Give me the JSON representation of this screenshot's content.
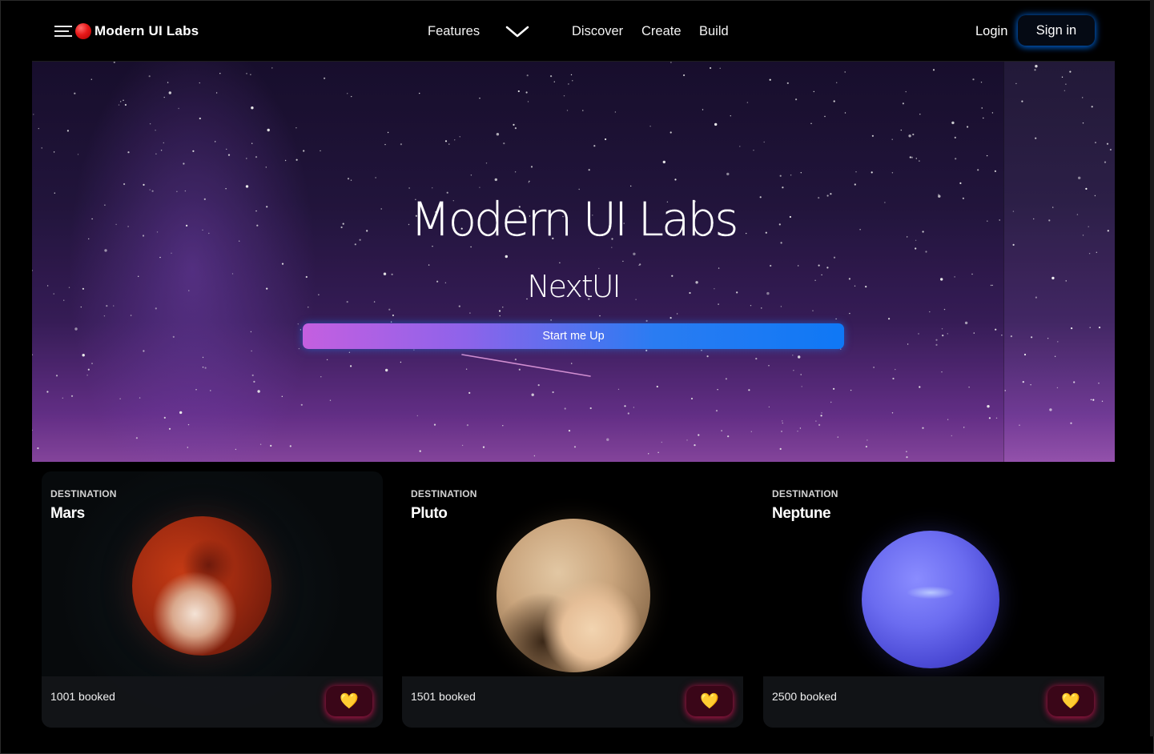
{
  "navbar": {
    "brand": "Modern UI Labs",
    "links": {
      "features": "Features",
      "discover": "Discover",
      "create": "Create",
      "build": "Build"
    },
    "login": "Login",
    "sign_in": "Sign in",
    "icons": {
      "menu": "menu-icon",
      "logo": "red-circle-logo",
      "features_dropdown": "chevron-down-icon"
    }
  },
  "hero": {
    "title": "Modern UI Labs",
    "subtitle": "NextUI",
    "cta": "Start me Up"
  },
  "cards": [
    {
      "eyebrow": "DESTINATION",
      "title": "Mars",
      "booked": "1001 booked",
      "like_icon": "💛"
    },
    {
      "eyebrow": "DESTINATION",
      "title": "Pluto",
      "booked": "1501 booked",
      "like_icon": "💛"
    },
    {
      "eyebrow": "DESTINATION",
      "title": "Neptune",
      "booked": "2500 booked",
      "like_icon": "💛"
    }
  ],
  "colors": {
    "accent_blue": "#0f78f5",
    "cta_gradient_start": "#c45fe0",
    "like_glow": "#c81450",
    "background": "#000000"
  }
}
